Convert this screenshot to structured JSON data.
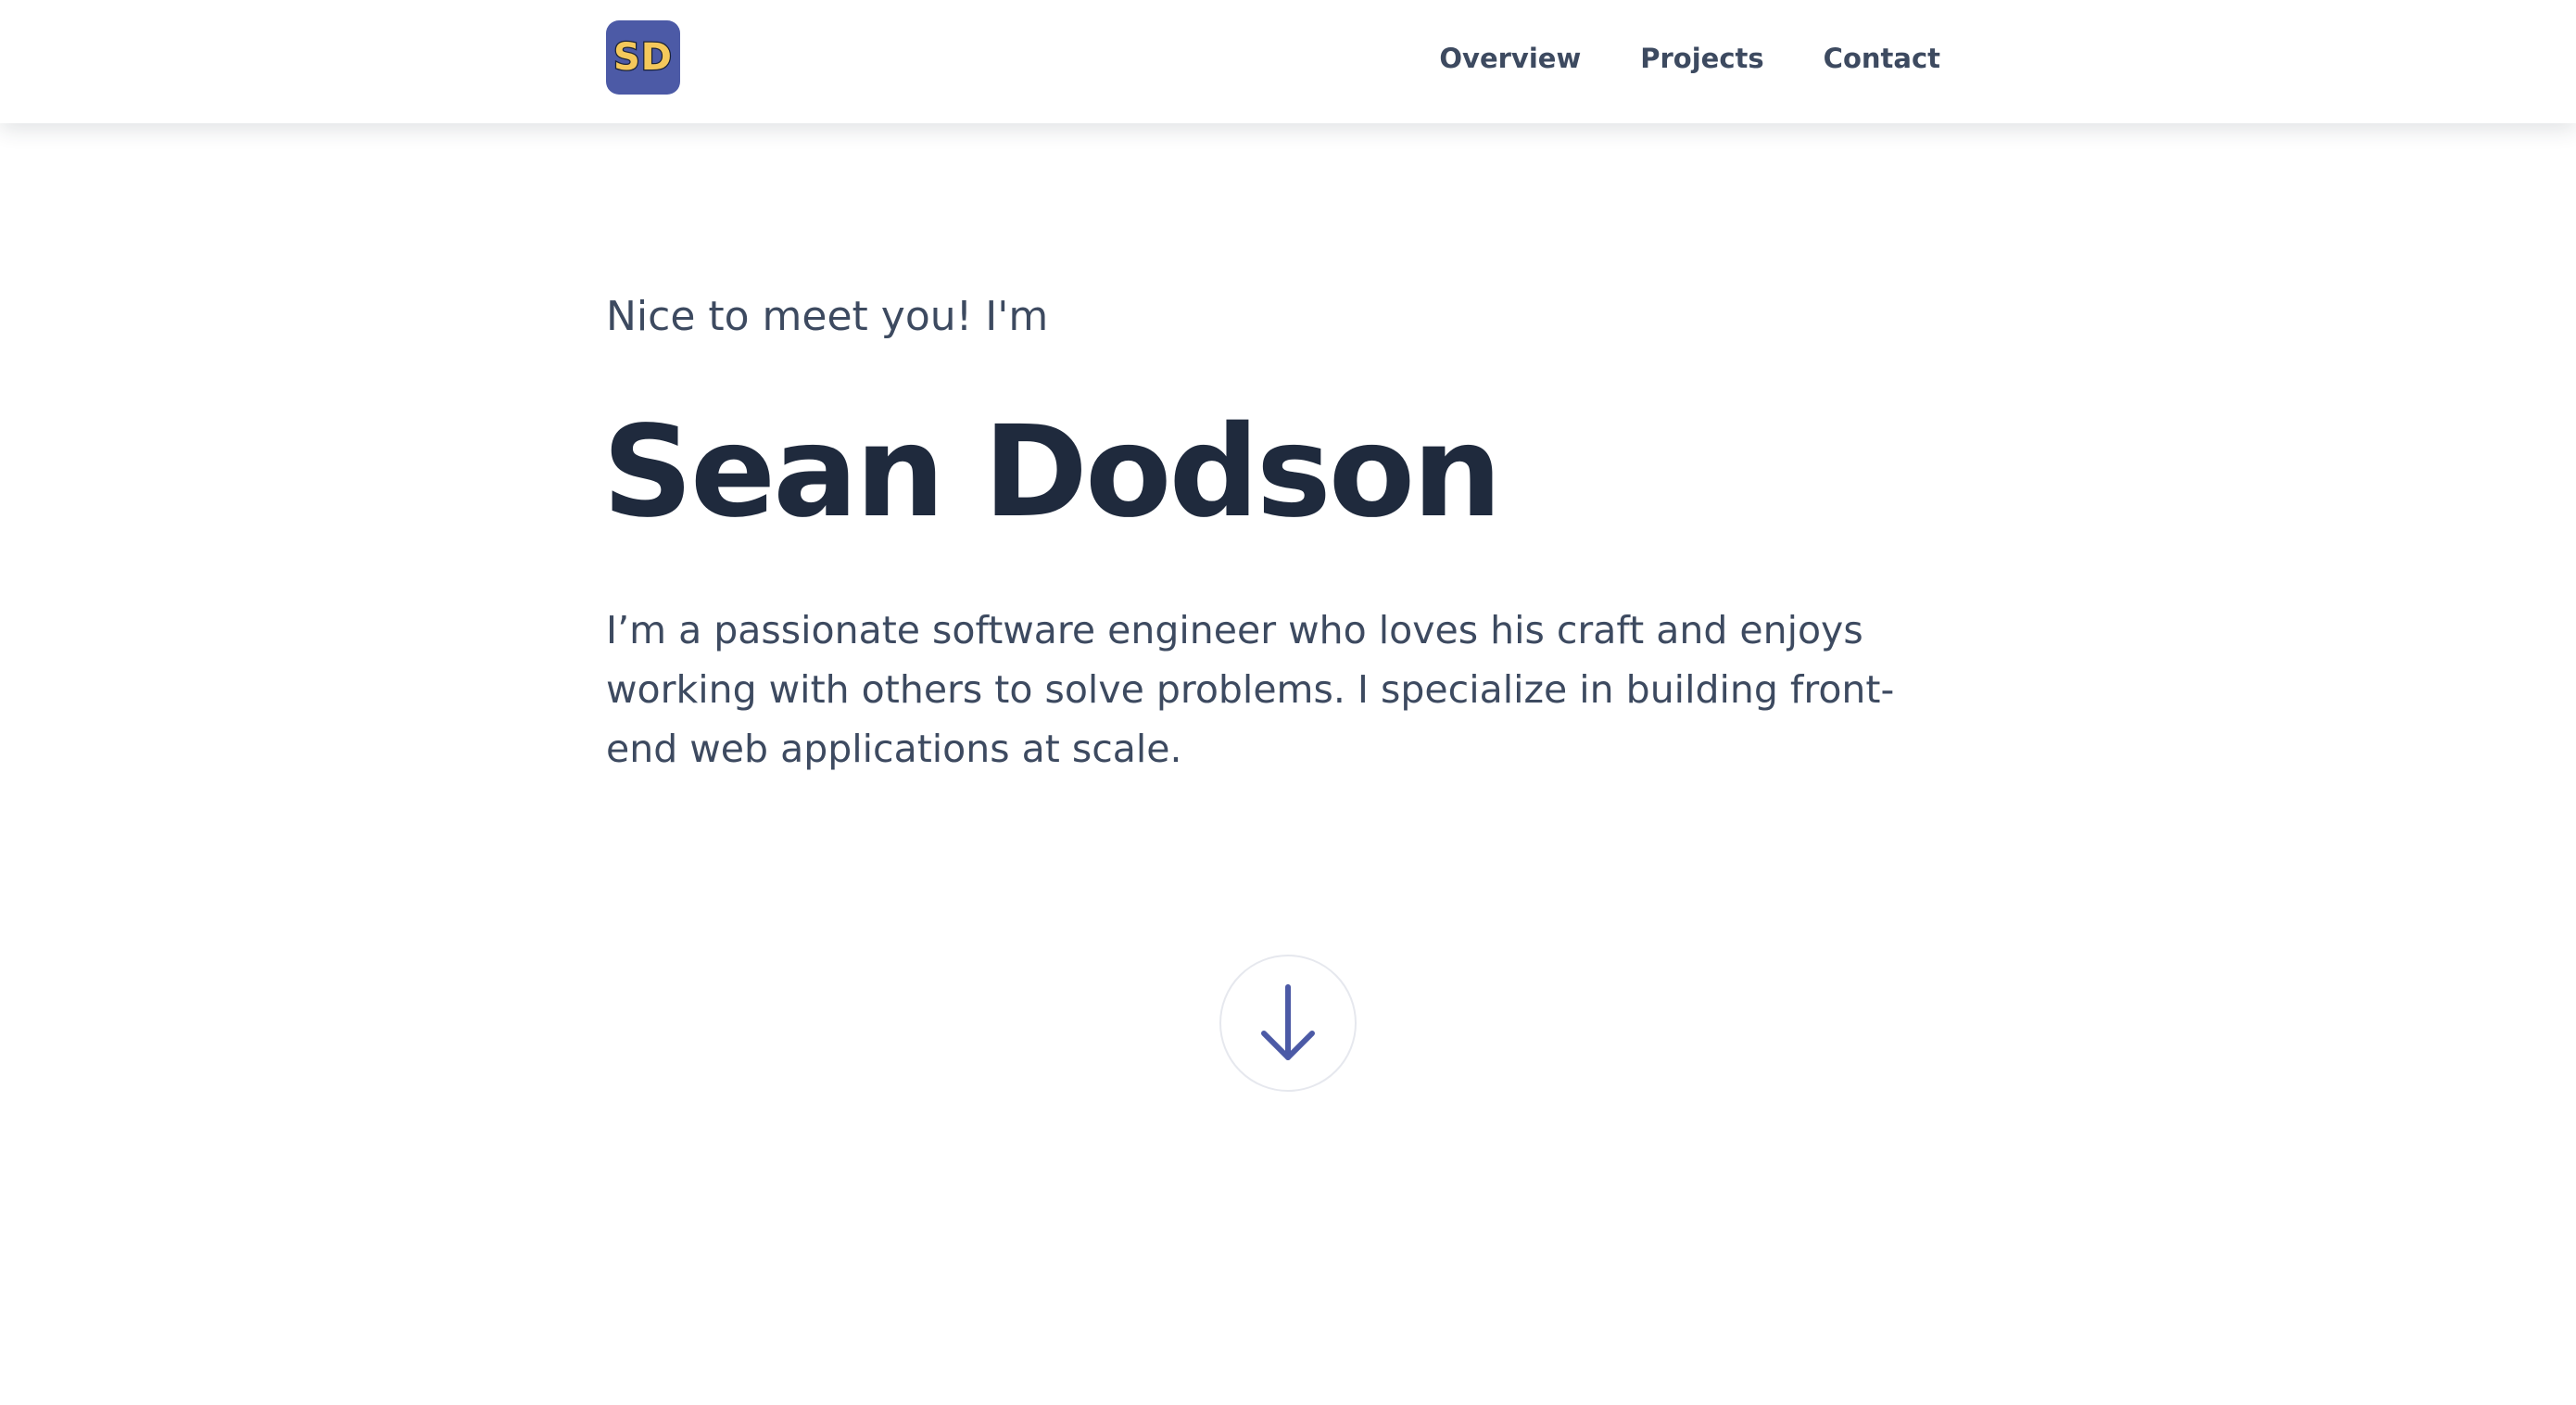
{
  "header": {
    "logo_text": "SD",
    "nav": [
      {
        "label": "Overview"
      },
      {
        "label": "Projects"
      },
      {
        "label": "Contact"
      }
    ]
  },
  "hero": {
    "greeting": "Nice to meet you! I'm",
    "name": "Sean Dodson",
    "bio": "I’m a passionate software engineer who loves his craft and enjoys working with others to solve problems. I specialize in building front-end web applications at scale."
  },
  "scroll_button": {
    "icon": "arrow-down-icon"
  },
  "colors": {
    "logo_background": "#4c5aa6",
    "logo_text": "#f4c85b",
    "heading": "#1f2a3d",
    "body_text": "#3d4a60",
    "accent": "#4c5aa6"
  }
}
